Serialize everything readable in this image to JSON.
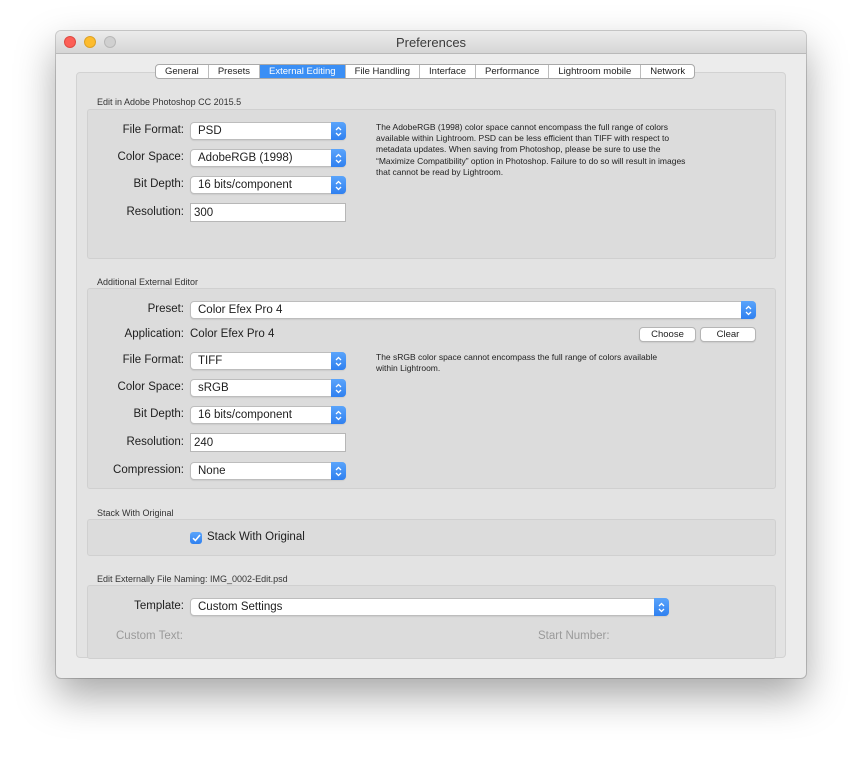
{
  "window": {
    "title": "Preferences"
  },
  "tabs": [
    {
      "label": "General",
      "active": false
    },
    {
      "label": "Presets",
      "active": false
    },
    {
      "label": "External Editing",
      "active": true
    },
    {
      "label": "File Handling",
      "active": false
    },
    {
      "label": "Interface",
      "active": false
    },
    {
      "label": "Performance",
      "active": false
    },
    {
      "label": "Lightroom mobile",
      "active": false
    },
    {
      "label": "Network",
      "active": false
    }
  ],
  "photoshop": {
    "section_label": "Edit in Adobe Photoshop CC 2015.5",
    "file_format_label": "File Format:",
    "file_format": "PSD",
    "color_space_label": "Color Space:",
    "color_space": "AdobeRGB (1998)",
    "bit_depth_label": "Bit Depth:",
    "bit_depth": "16 bits/component",
    "resolution_label": "Resolution:",
    "resolution": "300",
    "note": "The AdobeRGB (1998) color space cannot encompass the full range of colors available within Lightroom. PSD can be less efficient than TIFF with respect to metadata updates. When saving from Photoshop, please be sure to use the “Maximize Compatibility” option in Photoshop. Failure to do so will result in images that cannot be read by Lightroom."
  },
  "additional": {
    "section_label": "Additional External Editor",
    "preset_label": "Preset:",
    "preset": "Color Efex Pro 4",
    "application_label": "Application:",
    "application": "Color Efex Pro 4",
    "choose_label": "Choose",
    "clear_label": "Clear",
    "file_format_label": "File Format:",
    "file_format": "TIFF",
    "color_space_label": "Color Space:",
    "color_space": "sRGB",
    "bit_depth_label": "Bit Depth:",
    "bit_depth": "16 bits/component",
    "resolution_label": "Resolution:",
    "resolution": "240",
    "compression_label": "Compression:",
    "compression": "None",
    "note": "The sRGB color space cannot encompass the full range of colors available within Lightroom."
  },
  "stack": {
    "section_label": "Stack With Original",
    "checkbox_label": "Stack With Original",
    "checked": true
  },
  "naming": {
    "section_label": "Edit Externally File Naming:  IMG_0002-Edit.psd",
    "template_label": "Template:",
    "template": "Custom Settings",
    "custom_text_label": "Custom Text:",
    "start_number_label": "Start Number:"
  },
  "colors": {
    "accent": "#3b8ff5",
    "close": "#fc5f57",
    "minimize": "#fdbc2e",
    "maximize": "#d0d0d0"
  }
}
